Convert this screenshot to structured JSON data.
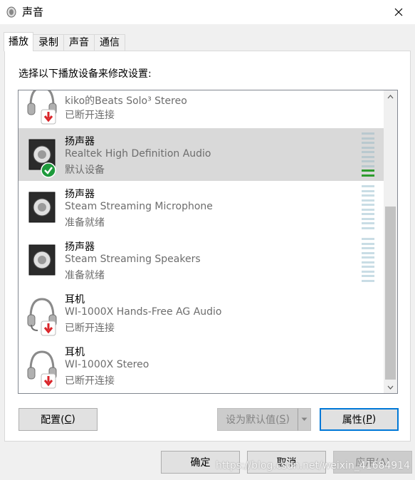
{
  "window": {
    "title": "声音"
  },
  "tabs": [
    {
      "label": "播放"
    },
    {
      "label": "录制"
    },
    {
      "label": "声音"
    },
    {
      "label": "通信"
    }
  ],
  "instruction": "选择以下播放设备来修改设置:",
  "devices": [
    {
      "name": "kiko的Beats Solo³ Stereo",
      "description": "",
      "status": "已断开连接",
      "icon": "headphones-icon",
      "badge": "disconnected-icon"
    },
    {
      "name": "扬声器",
      "description": "Realtek High Definition Audio",
      "status": "默认设备",
      "icon": "speaker-icon",
      "badge": "default-check-icon",
      "selected": true,
      "level": 0.2
    },
    {
      "name": "扬声器",
      "description": "Steam Streaming Microphone",
      "status": "准备就绪",
      "icon": "speaker-icon",
      "level": 0
    },
    {
      "name": "扬声器",
      "description": "Steam Streaming Speakers",
      "status": "准备就绪",
      "icon": "speaker-icon",
      "level": 0
    },
    {
      "name": "耳机",
      "description": "WI-1000X Hands-Free AG Audio",
      "status": "已断开连接",
      "icon": "headset-icon",
      "badge": "disconnected-icon"
    },
    {
      "name": "耳机",
      "description": "WI-1000X Stereo",
      "status": "已断开连接",
      "icon": "headphones-icon",
      "badge": "disconnected-icon"
    }
  ],
  "buttons": {
    "configure": "配置(",
    "configure_key": "C",
    "configure_end": ")",
    "set_default": "设为默认值(",
    "set_default_key": "S",
    "set_default_end": ")",
    "properties": "属性(",
    "properties_key": "P",
    "properties_end": ")",
    "ok": "确定",
    "cancel": "取消",
    "apply": "应用(A)"
  },
  "watermark": "https://blog.csdn.net/weixin_41684914",
  "colors": {
    "selected_row": "#d9d9d9",
    "meter_active": "#2e9c2e",
    "meter_idle": "#c9dde5",
    "primary_border": "#0078d7",
    "disconnected_badge": "#d9252a",
    "default_badge": "#1e9a3c"
  }
}
